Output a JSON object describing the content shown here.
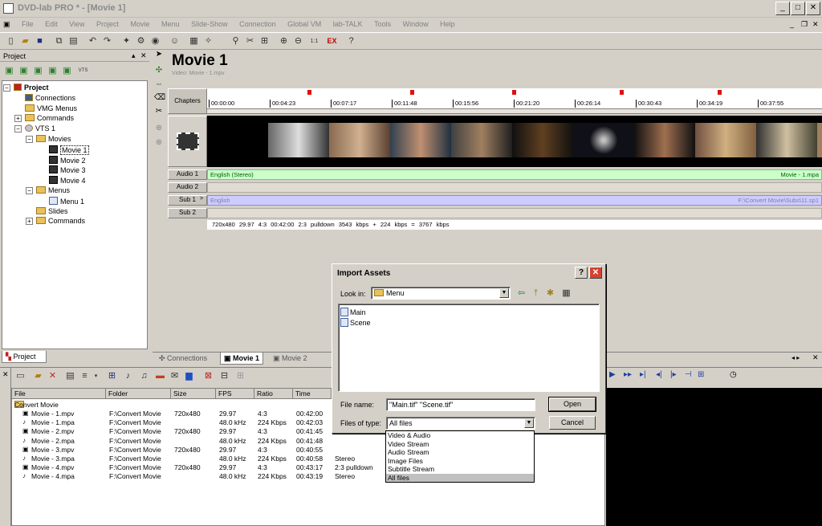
{
  "window": {
    "title": "DVD-lab PRO * - [Movie 1]",
    "minimize": "_",
    "maximize": "□",
    "close": "✕"
  },
  "menu": [
    "File",
    "Edit",
    "View",
    "Project",
    "Movie",
    "Menu",
    "Slide-Show",
    "Connection",
    "Global VM",
    "lab-TALK",
    "Tools",
    "Window",
    "Help"
  ],
  "project_panel": {
    "title": "Project",
    "vts_label": "VTS",
    "tree": [
      {
        "label": "Project",
        "indent": 0,
        "bold": true,
        "expander": "−",
        "icon": "proj"
      },
      {
        "label": "Connections",
        "indent": 1,
        "icon": "conn"
      },
      {
        "label": "VMG Menus",
        "indent": 1,
        "icon": "folder"
      },
      {
        "label": "Commands",
        "indent": 1,
        "icon": "folder",
        "expander": "+"
      },
      {
        "label": "VTS 1",
        "indent": 1,
        "icon": "disc",
        "expander": "−"
      },
      {
        "label": "Movies",
        "indent": 2,
        "icon": "folder",
        "expander": "−"
      },
      {
        "label": "Movie 1",
        "indent": 3,
        "icon": "movie",
        "selected": true
      },
      {
        "label": "Movie 2",
        "indent": 3,
        "icon": "movie"
      },
      {
        "label": "Movie 3",
        "indent": 3,
        "icon": "movie"
      },
      {
        "label": "Movie 4",
        "indent": 3,
        "icon": "movie"
      },
      {
        "label": "Menus",
        "indent": 2,
        "icon": "folder",
        "expander": "−"
      },
      {
        "label": "Menu 1",
        "indent": 3,
        "icon": "menu"
      },
      {
        "label": "Slides",
        "indent": 2,
        "icon": "folder"
      },
      {
        "label": "Commands",
        "indent": 2,
        "icon": "folder",
        "expander": "+"
      }
    ],
    "tab": "Project"
  },
  "movie": {
    "title": "Movie 1",
    "subtitle": "Video: Movie - 1.mpv",
    "rows": {
      "chapters": "Chapters",
      "audio1": "Audio 1",
      "audio2": "Audio 2",
      "sub1": "Sub 1",
      "sub2": "Sub 2"
    },
    "ticks": [
      "00:00:00",
      "00:04:23",
      "00:07:17",
      "00:11:48",
      "00:15:56",
      "00:21:20",
      "00:26:14",
      "00:30:43",
      "00:34:19",
      "00:37:55"
    ],
    "audio1_left": "English (Stereo)",
    "audio1_right": "Movie - 1.mpa",
    "sub1_left": "English",
    "sub1_right": "F:\\Convert Movie\\Subs\\11.sp1",
    "sub1_arrow": ">",
    "info": "720x480   29.97   4:3   00:42:00   2:3 pulldown   3543 kbps + 224 kbps = 3767 kbps"
  },
  "mid_tabs": [
    "Connections",
    "Movie 1",
    "Movie 2"
  ],
  "files": {
    "headers": [
      "File",
      "Folder",
      "Size",
      "FPS",
      "Ratio",
      "Time"
    ],
    "group": "Convert Movie",
    "rows": [
      {
        "name": "Movie - 1.mpv",
        "folder": "F:\\Convert Movie",
        "size": "720x480",
        "fps": "29.97",
        "ratio": "4:3",
        "time": "00:42:00",
        "extra": "",
        "type": "video"
      },
      {
        "name": "Movie - 1.mpa",
        "folder": "F:\\Convert Movie",
        "size": "",
        "fps": "48.0 kHz",
        "ratio": "224 Kbps",
        "time": "00:42:03",
        "extra": "",
        "type": "audio"
      },
      {
        "name": "Movie - 2.mpv",
        "folder": "F:\\Convert Movie",
        "size": "720x480",
        "fps": "29.97",
        "ratio": "4:3",
        "time": "00:41:45",
        "extra": "",
        "type": "video"
      },
      {
        "name": "Movie - 2.mpa",
        "folder": "F:\\Convert Movie",
        "size": "",
        "fps": "48.0 kHz",
        "ratio": "224 Kbps",
        "time": "00:41:48",
        "extra": "",
        "type": "audio"
      },
      {
        "name": "Movie - 3.mpv",
        "folder": "F:\\Convert Movie",
        "size": "720x480",
        "fps": "29.97",
        "ratio": "4:3",
        "time": "00:40:55",
        "extra": "",
        "type": "video"
      },
      {
        "name": "Movie - 3.mpa",
        "folder": "F:\\Convert Movie",
        "size": "",
        "fps": "48.0 kHz",
        "ratio": "224 Kbps",
        "time": "00:40:58",
        "extra": "Stereo",
        "type": "audio"
      },
      {
        "name": "Movie - 4.mpv",
        "folder": "F:\\Convert Movie",
        "size": "720x480",
        "fps": "29.97",
        "ratio": "4:3",
        "time": "00:43:17",
        "extra": "2:3 pulldown",
        "type": "video"
      },
      {
        "name": "Movie - 4.mpa",
        "folder": "F:\\Convert Movie",
        "size": "",
        "fps": "48.0 kHz",
        "ratio": "224 Kbps",
        "time": "00:43:19",
        "extra": "Stereo",
        "type": "audio"
      }
    ],
    "stereo_col": "Stereo"
  },
  "dialog": {
    "title": "Import Assets",
    "help": "?",
    "close": "✕",
    "look_in_label": "Look in:",
    "look_in_value": "Menu",
    "items": [
      "Main",
      "Scene"
    ],
    "file_name_label": "File name:",
    "file_name_value": "\"Main.tif\" \"Scene.tif\"",
    "file_type_label": "Files of type:",
    "file_type_value": "All files",
    "open": "Open",
    "cancel": "Cancel",
    "type_options": [
      "Video & Audio",
      "Video Stream",
      "Audio Stream",
      "Image Files",
      "Subtitle Stream",
      "All files"
    ]
  }
}
